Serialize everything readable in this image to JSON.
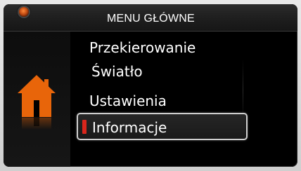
{
  "header": {
    "title": "MENU GŁÓWNE"
  },
  "sidebar": {
    "icon": "home-icon",
    "icon_color": "#e8650a"
  },
  "menu": {
    "items": [
      {
        "label": "Przekierowanie"
      },
      {
        "label": "Światło"
      },
      {
        "label": "Ustawienia"
      },
      {
        "label": "Informacje",
        "selected": true
      }
    ]
  },
  "colors": {
    "accent": "#d9261c",
    "screen_bg": "#000000",
    "text": "#ffffff",
    "led": "#ff8a3a"
  }
}
